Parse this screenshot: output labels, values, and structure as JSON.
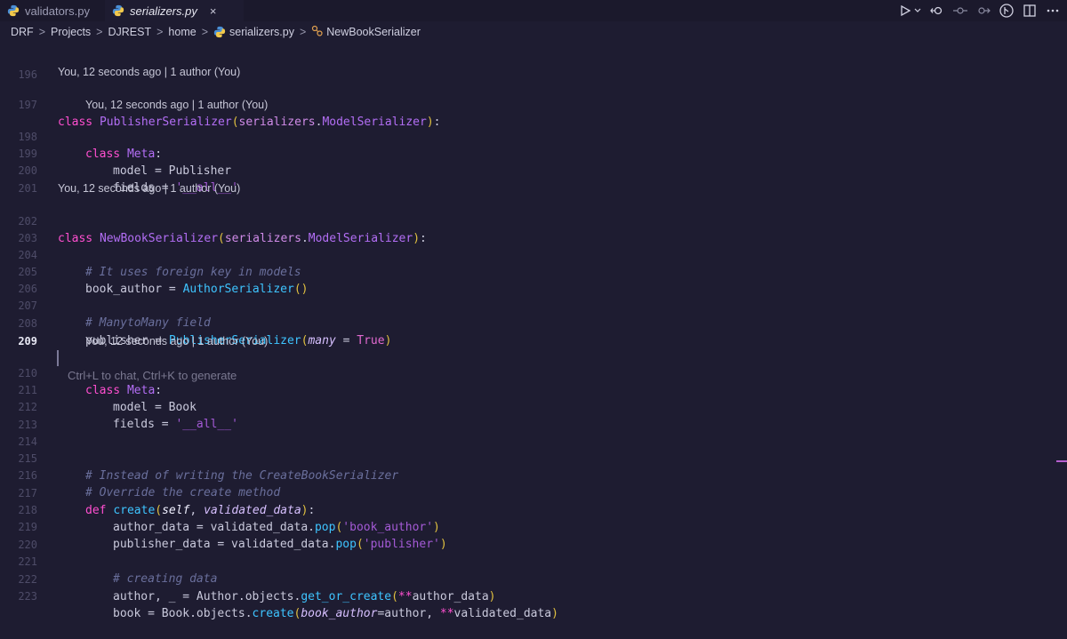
{
  "tabs": [
    {
      "label": "validators.py",
      "icon": "python-icon",
      "active": false
    },
    {
      "label": "serializers.py",
      "icon": "python-icon",
      "active": true,
      "close": "×"
    }
  ],
  "toolbar": {
    "icons": [
      "run-icon",
      "chevron-down-icon",
      "git-compare-icon",
      "git-commit-icon",
      "git-branch-icon",
      "accounts-icon",
      "split-editor-icon",
      "more-icon"
    ]
  },
  "breadcrumb": {
    "items": [
      "DRF",
      "Projects",
      "DJREST",
      "home",
      "serializers.py",
      "NewBookSerializer"
    ],
    "separator": ">"
  },
  "editor": {
    "blame_text": "You, 12 seconds ago | 1 author (You)",
    "hint_text": "Ctrl+L to chat, Ctrl+K to generate",
    "current_line": "209",
    "line_numbers": [
      "196",
      "197",
      "198",
      "199",
      "200",
      "201",
      "202",
      "203",
      "204",
      "205",
      "206",
      "207",
      "208",
      "209",
      "210",
      "211",
      "212",
      "213",
      "214",
      "215",
      "216",
      "217",
      "218",
      "219",
      "220",
      "221",
      "222",
      "223"
    ],
    "code": {
      "l197": {
        "kw": "class",
        "name": "PublisherSerializer",
        "paren_open": "(",
        "base_a": "serializers",
        "dot": ".",
        "base_b": "ModelSerializer",
        "paren_close": ")",
        "colon": ":"
      },
      "l198": {
        "kw": "class",
        "name": "Meta",
        "colon": ":"
      },
      "l199": {
        "text": "model = Publisher"
      },
      "l200": {
        "lhs": "fields = ",
        "str": "'__all__'"
      },
      "l202": {
        "kw": "class",
        "name": "NewBookSerializer",
        "paren_open": "(",
        "base_a": "serializers",
        "dot": ".",
        "base_b": "ModelSerializer",
        "paren_close": ")",
        "colon": ":"
      },
      "l204": {
        "comment": "# It uses foreign key in models"
      },
      "l205": {
        "lhs": "book_author = ",
        "call": "AuthorSerializer",
        "parens": "()"
      },
      "l207": {
        "comment": "# ManytoMany field"
      },
      "l208": {
        "lhs": "publisher = ",
        "call": "PublisherSerializer",
        "po": "(",
        "param": "many",
        "eq": " = ",
        "val": "True",
        "pc": ")"
      },
      "l210": {
        "kw": "class",
        "name": "Meta",
        "colon": ":"
      },
      "l211": {
        "text": "model = Book"
      },
      "l212": {
        "lhs": "fields = ",
        "str": "'__all__'"
      },
      "l215": {
        "comment": "# Instead of writing the CreateBookSerializer"
      },
      "l216": {
        "comment": "# Override the create method"
      },
      "l217": {
        "kw": "def",
        "name": "create",
        "po": "(",
        "self": "self",
        "comma": ", ",
        "param": "validated_data",
        "pc": ")",
        "colon": ":"
      },
      "l218": {
        "lhs": "author_data = validated_data.",
        "call": "pop",
        "po": "(",
        "str": "'book_author'",
        "pc": ")"
      },
      "l219": {
        "lhs": "publisher_data = validated_data.",
        "call": "pop",
        "po": "(",
        "str": "'publisher'",
        "pc": ")"
      },
      "l221": {
        "comment": "# creating data"
      },
      "l222": {
        "lhs": "author, _ = Author.objects.",
        "call": "get_or_create",
        "po": "(",
        "op": "**",
        "arg": "author_data",
        "pc": ")"
      },
      "l223": {
        "lhs": "book = Book.objects.",
        "call": "create",
        "po": "(",
        "param": "book_author",
        "eq": "=author, ",
        "op": "**",
        "arg": "validated_data",
        "pc": ")"
      }
    }
  },
  "colors": {
    "background": "#1e1c31",
    "keyword": "#ff4fd0",
    "class_name": "#b36ef5",
    "function": "#3ec4ff",
    "string": "#a45ad6",
    "comment": "#6a6f9c"
  }
}
